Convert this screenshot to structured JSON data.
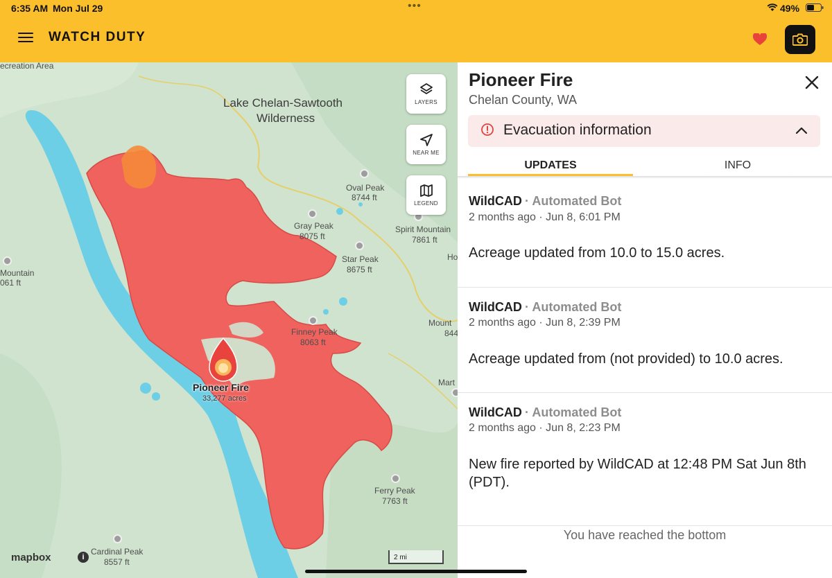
{
  "status": {
    "time": "6:35 AM",
    "date": "Mon Jul 29",
    "dots": "•••",
    "battery": "49%"
  },
  "header": {
    "title": "WATCH DUTY"
  },
  "map": {
    "buttons": {
      "layers": "LAYERS",
      "near_me": "NEAR ME",
      "legend": "LEGEND"
    },
    "labels": {
      "recreation": "ecreation Area",
      "wilderness_1": "Lake Chelan-Sawtooth",
      "wilderness_2": "Wilderness",
      "oval_peak": "Oval Peak",
      "oval_peak_ft": "8744 ft",
      "gray_peak": "Gray Peak",
      "gray_peak_ft": "8075 ft",
      "spirit_mountain": "Spirit Mountain",
      "spirit_mountain_ft": "7861 ft",
      "ho": "Ho",
      "star_peak": "Star Peak",
      "star_peak_ft": "8675 ft",
      "mountain_left": "Mountain",
      "mountain_left_ft": "061 ft",
      "finney_peak": "Finney Peak",
      "finney_peak_ft": "8063 ft",
      "mount_right": "Mount",
      "mount_right_ft": "844",
      "mart": "Mart",
      "ferry_peak": "Ferry Peak",
      "ferry_peak_ft": "7763 ft",
      "cardinal_peak": "Cardinal Peak",
      "cardinal_peak_ft": "8557 ft"
    },
    "fire_label": "Pioneer Fire",
    "fire_acres": "33,277 acres",
    "attribution": "mapbox",
    "info": "i",
    "scale": "2 mi",
    "colors": {
      "water": "#6dcfe6",
      "fire": "#f0625d",
      "fire_new": "#f58a3a",
      "land": "#cfe3cf"
    }
  },
  "panel": {
    "title": "Pioneer Fire",
    "location": "Chelan County, WA",
    "evacuation_label": "Evacuation information",
    "tabs": [
      "UPDATES",
      "INFO"
    ],
    "updates": [
      {
        "author": "WildCAD",
        "role": "· Automated Bot",
        "time": "2 months ago · Jun 8, 6:01 PM",
        "body": "Acreage updated from 10.0 to 15.0 acres."
      },
      {
        "author": "WildCAD",
        "role": "· Automated Bot",
        "time": "2 months ago · Jun 8, 2:39 PM",
        "body": "Acreage updated from (not provided) to 10.0 acres."
      },
      {
        "author": "WildCAD",
        "role": "· Automated Bot",
        "time": "2 months ago · Jun 8, 2:23 PM",
        "body": "New fire reported by WildCAD at 12:48 PM Sat Jun 8th (PDT)."
      }
    ],
    "end_note": "You have reached the bottom"
  }
}
